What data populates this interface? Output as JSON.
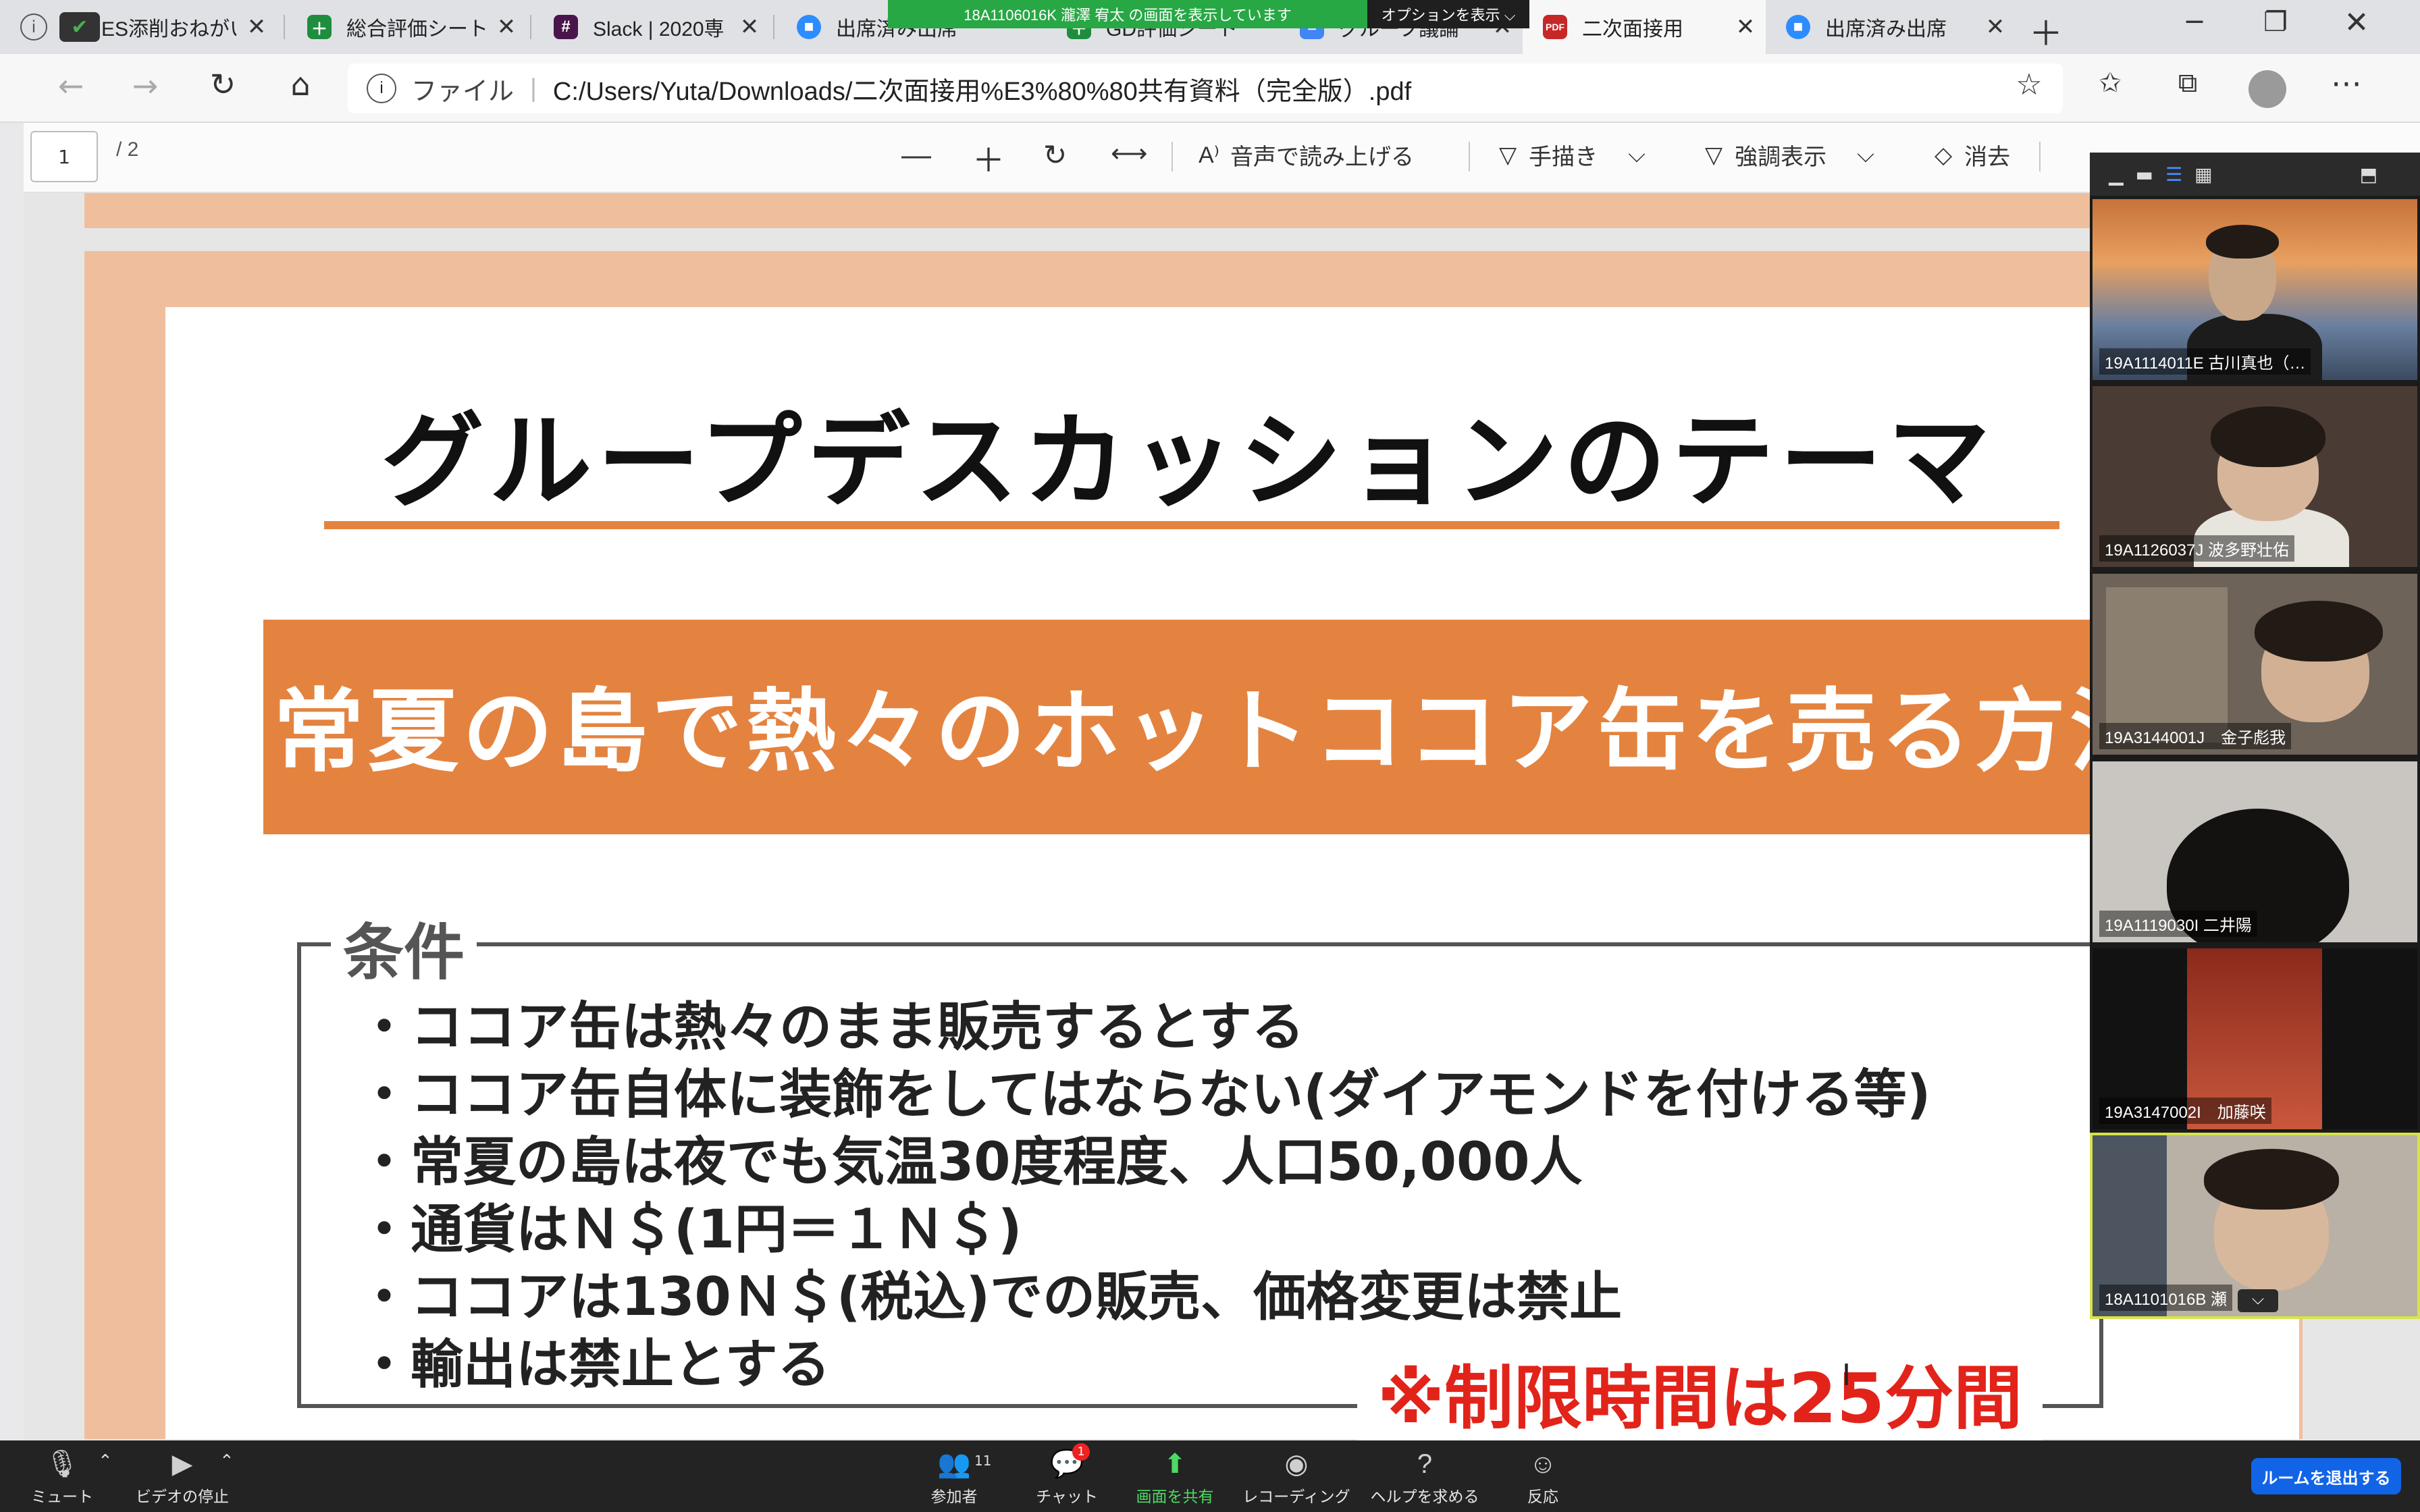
{
  "browser": {
    "tabs": [
      {
        "title": "ES添削おねがい",
        "icon": "zoom-camera-icon"
      },
      {
        "title": "総合評価シート",
        "icon": "sheets-icon"
      },
      {
        "title": "Slack | 2020専",
        "icon": "slack-icon"
      },
      {
        "title": "出席済み出席",
        "icon": "zoom-camera-icon"
      },
      {
        "title": "GD評価シート",
        "icon": "sheets-icon"
      },
      {
        "title": "グループ議論",
        "icon": "docs-icon"
      },
      {
        "title": "二次面接用",
        "icon": "pdf-icon"
      },
      {
        "title": "出席済み出席",
        "icon": "zoom-camera-icon"
      }
    ],
    "share_banner": "18A1106016K 瀧澤 宥太 の画面を表示しています",
    "share_options": "オプションを表示 ⌵",
    "address": {
      "scheme_label": "ファイル",
      "url": "C:/Users/Yuta/Downloads/二次面接用%E3%80%80共有資料（完全版）.pdf"
    }
  },
  "pdf_toolbar": {
    "page_number": "1",
    "page_total": "/ 2",
    "read_aloud": "音声で読み上げる",
    "draw": "手描き",
    "highlight": "強調表示",
    "erase": "消去"
  },
  "slide": {
    "title": "グループデスカッションのテーマ",
    "theme": "常夏の島で熱々のホットココア缶を売る方法",
    "conditions_label": "条件",
    "conditions": [
      "ココア缶は熱々のまま販売するとする",
      "ココア缶自体に装飾をしてはならない(ダイアモンドを付ける等)",
      "常夏の島は夜でも気温30度程度、人口50,000人",
      "通貨はＮ＄(1円＝１Ｎ＄)",
      "ココアは130Ｎ＄(税込)での販売、価格変更は禁止",
      "輸出は禁止とする"
    ],
    "time_limit": "※制限時間は25分間"
  },
  "zoom": {
    "participants": [
      {
        "name": "19A1114011E 古川真也（…"
      },
      {
        "name": "19A1126037J 波多野壮佑"
      },
      {
        "name": "19A3144001J　金子彪我"
      },
      {
        "name": "19A1119030I 二井陽"
      },
      {
        "name": "19A3147002I　加藤咲"
      },
      {
        "name": "18A1101016B 瀬"
      }
    ],
    "controls": {
      "mute": "ミュート",
      "video": "ビデオの停止",
      "participants": "参加者",
      "participants_count": "11",
      "chat": "チャット",
      "chat_badge": "1",
      "share": "画面を共有",
      "record": "レコーディング",
      "help": "ヘルプを求める",
      "reactions": "反応",
      "leave": "ルームを退出する"
    }
  }
}
